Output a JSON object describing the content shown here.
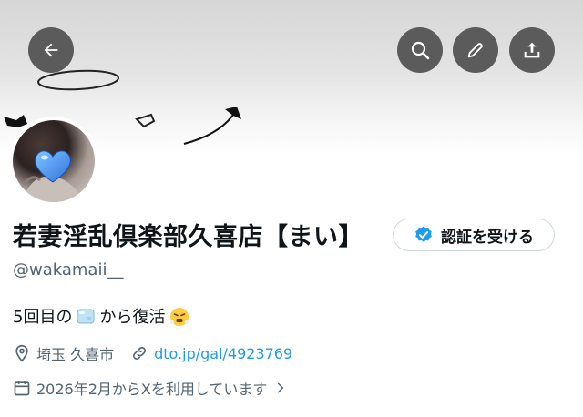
{
  "profile": {
    "display_name": "若妻淫乱倶楽部久喜店【まい】",
    "handle": "@wakamaii__",
    "bio_prefix": "5回目の",
    "bio_suffix": "から復活",
    "location": "埼玉 久喜市",
    "website": "dto.jp/gal/4923769",
    "joined": "2026年2月からXを利用しています"
  },
  "buttons": {
    "verify_label": "認証を受ける"
  },
  "icons": {
    "back": "arrow-left-icon",
    "search": "search-icon",
    "edit": "pencil-icon",
    "share": "share-icon",
    "verified": "verified-badge-icon",
    "location": "location-pin-icon",
    "link": "link-icon",
    "calendar": "calendar-icon",
    "chevron": "chevron-right-icon"
  },
  "colors": {
    "accent": "#1d9bf0",
    "muted_text": "#536471",
    "action_button": "#5b5b5b"
  }
}
